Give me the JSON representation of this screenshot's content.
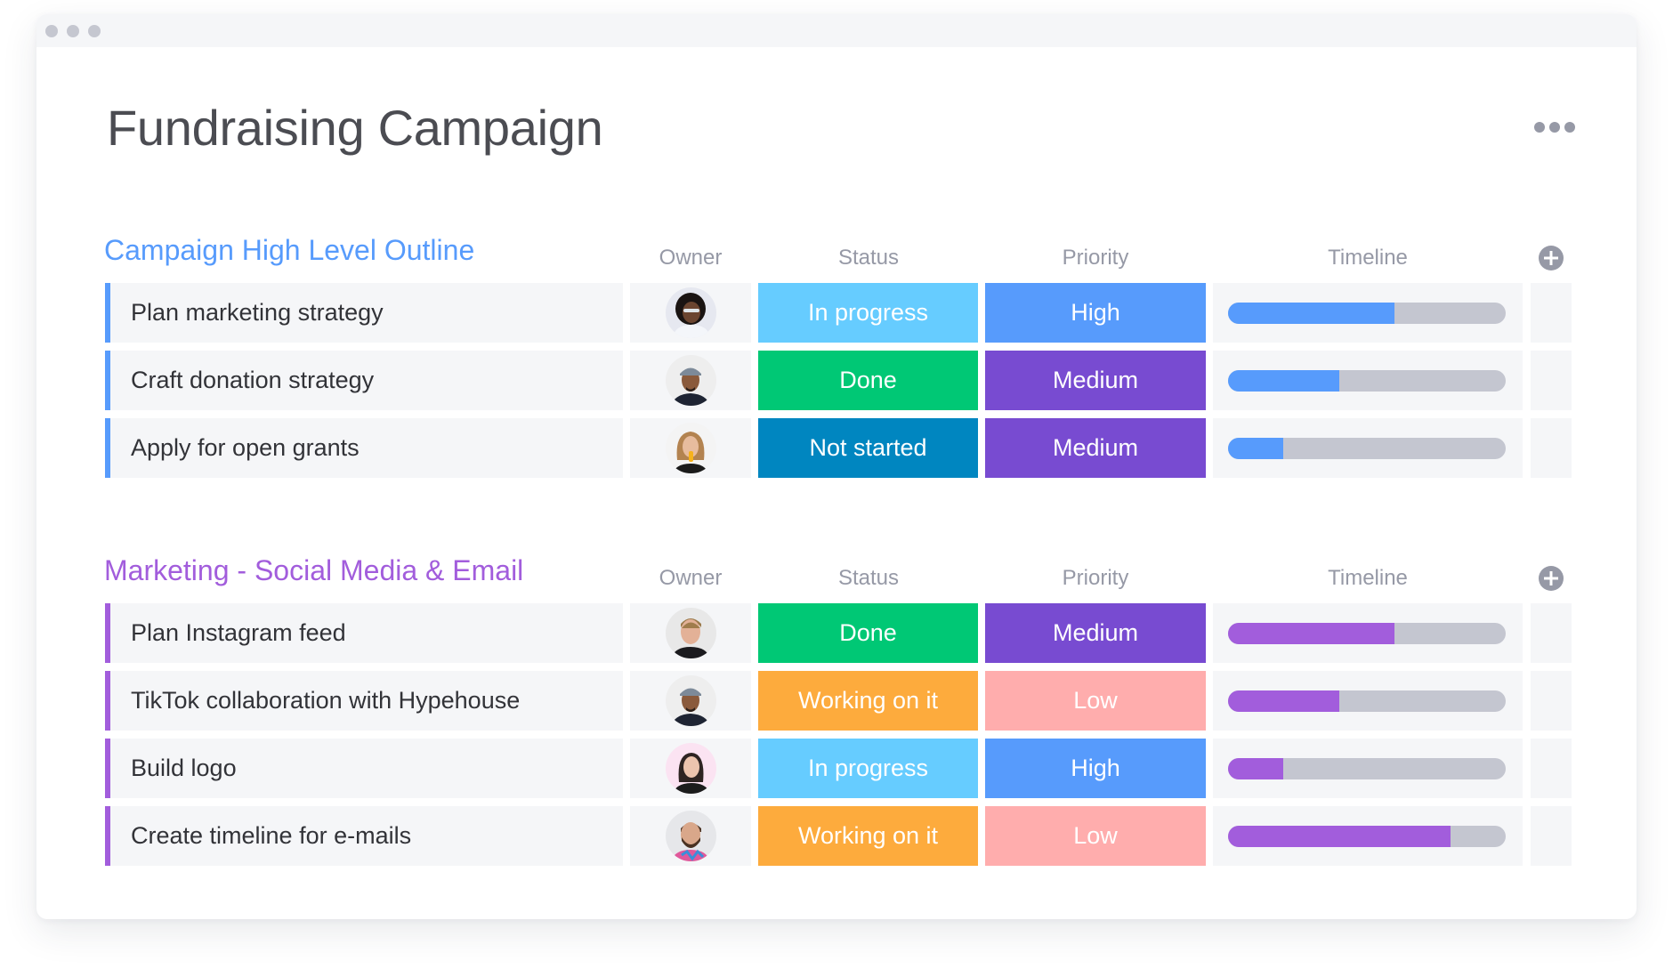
{
  "window": {
    "controls": [
      "close",
      "minimize",
      "maximize"
    ]
  },
  "board": {
    "title": "Fundraising Campaign",
    "menu_icon": "more-horizontal-icon"
  },
  "colors": {
    "status": {
      "In progress": "#66ccff",
      "Done": "#00c875",
      "Not started": "#0086c0",
      "Working on it": "#fdab3d"
    },
    "priority": {
      "High": "#579bfc",
      "Medium": "#784bd1",
      "Low": "#ffadad"
    },
    "timeline_track": "#c4c6d0"
  },
  "groups": [
    {
      "title": "Campaign High Level Outline",
      "color": "#579bfc",
      "columns": {
        "owner": "Owner",
        "status": "Status",
        "priority": "Priority",
        "timeline": "Timeline"
      },
      "add_column_icon": "plus-circle-icon",
      "rows": [
        {
          "task": "Plan marketing strategy",
          "owner_avatar": "avatar-woman-glasses",
          "status": "In progress",
          "priority": "High",
          "timeline_progress": 0.6
        },
        {
          "task": "Craft donation strategy",
          "owner_avatar": "avatar-man-cap",
          "status": "Done",
          "priority": "Medium",
          "timeline_progress": 0.4
        },
        {
          "task": "Apply for open grants",
          "owner_avatar": "avatar-woman-blonde",
          "status": "Not started",
          "priority": "Medium",
          "timeline_progress": 0.2
        }
      ]
    },
    {
      "title": "Marketing - Social Media & Email",
      "color": "#a25ddc",
      "columns": {
        "owner": "Owner",
        "status": "Status",
        "priority": "Priority",
        "timeline": "Timeline"
      },
      "add_column_icon": "plus-circle-icon",
      "rows": [
        {
          "task": "Plan Instagram feed",
          "owner_avatar": "avatar-man-blond",
          "status": "Done",
          "priority": "Medium",
          "timeline_progress": 0.6
        },
        {
          "task": "TikTok collaboration with Hypehouse",
          "owner_avatar": "avatar-man-cap",
          "status": "Working on it",
          "priority": "Low",
          "timeline_progress": 0.4
        },
        {
          "task": "Build logo",
          "owner_avatar": "avatar-woman-dark-hair",
          "status": "In progress",
          "priority": "High",
          "timeline_progress": 0.2
        },
        {
          "task": "Create timeline for e-mails",
          "owner_avatar": "avatar-man-beard",
          "status": "Working on it",
          "priority": "Low",
          "timeline_progress": 0.8
        }
      ]
    }
  ]
}
